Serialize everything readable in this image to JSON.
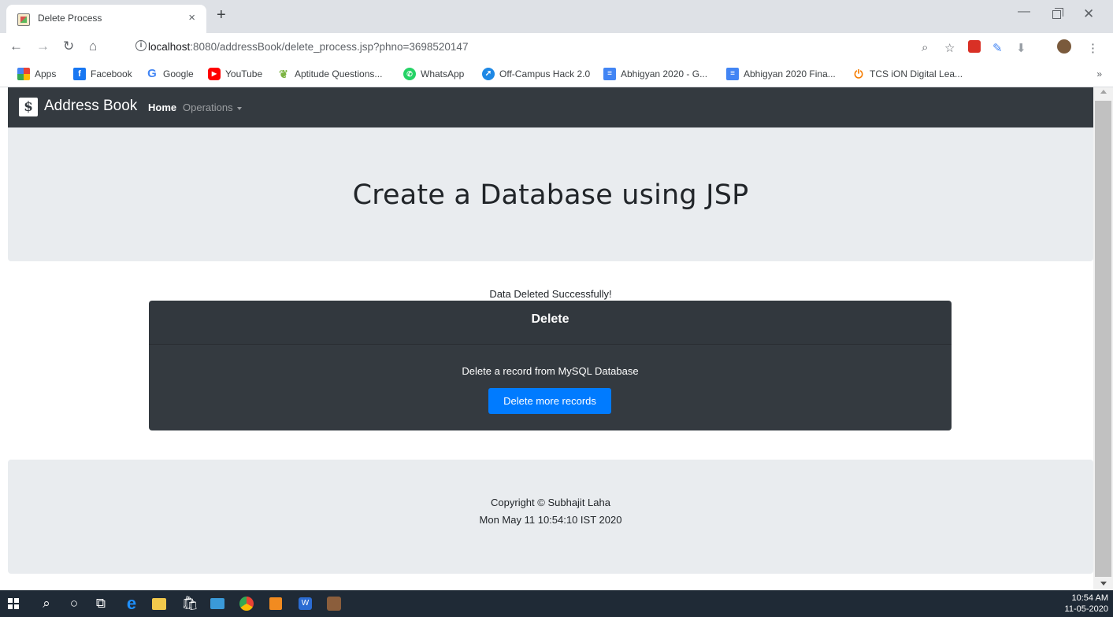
{
  "browser": {
    "tab_title": "Delete Process",
    "tab_close": "×",
    "new_tab": "+",
    "url_host": "localhost",
    "url_rest": ":8080/addressBook/delete_process.jsp?phno=3698520147",
    "bookmarks": [
      {
        "label": "Apps",
        "icon": "apps-grid-icon",
        "color": "#e94235"
      },
      {
        "label": "Facebook",
        "icon": "facebook-icon",
        "color": "#1877f2"
      },
      {
        "label": "Google",
        "icon": "google-icon",
        "color": "#4285f4"
      },
      {
        "label": "YouTube",
        "icon": "youtube-icon",
        "color": "#ff0000"
      },
      {
        "label": "Aptitude Questions...",
        "icon": "aptitude-icon",
        "color": "#7cb342"
      },
      {
        "label": "WhatsApp",
        "icon": "whatsapp-icon",
        "color": "#25d366"
      },
      {
        "label": "Off-Campus Hack 2.0",
        "icon": "hack-icon",
        "color": "#1e88e5"
      },
      {
        "label": "Abhigyan 2020 - G...",
        "icon": "docs-icon",
        "color": "#4285f4"
      },
      {
        "label": "Abhigyan 2020 Fina...",
        "icon": "docs-icon",
        "color": "#4285f4"
      },
      {
        "label": "TCS iON Digital Lea...",
        "icon": "tcs-icon",
        "color": "#f57c00"
      }
    ],
    "bookmarks_more": "»"
  },
  "navbar": {
    "brand_logo": "$",
    "brand": "Address Book",
    "home": "Home",
    "operations": "Operations"
  },
  "jumbotron": {
    "title": "Create a Database using JSP"
  },
  "status_message": "Data Deleted Successfully!",
  "card": {
    "header": "Delete",
    "text": "Delete a record from MySQL Database",
    "button": "Delete more records"
  },
  "footer": {
    "copyright": "Copyright © Subhajit Laha",
    "date": "Mon May 11 10:54:10 IST 2020"
  },
  "taskbar": {
    "time": "10:54 AM",
    "date": "11-05-2020"
  },
  "colors": {
    "navbar_bg": "#343a40",
    "jumbotron_bg": "#e9ecef",
    "button_primary": "#007bff"
  }
}
